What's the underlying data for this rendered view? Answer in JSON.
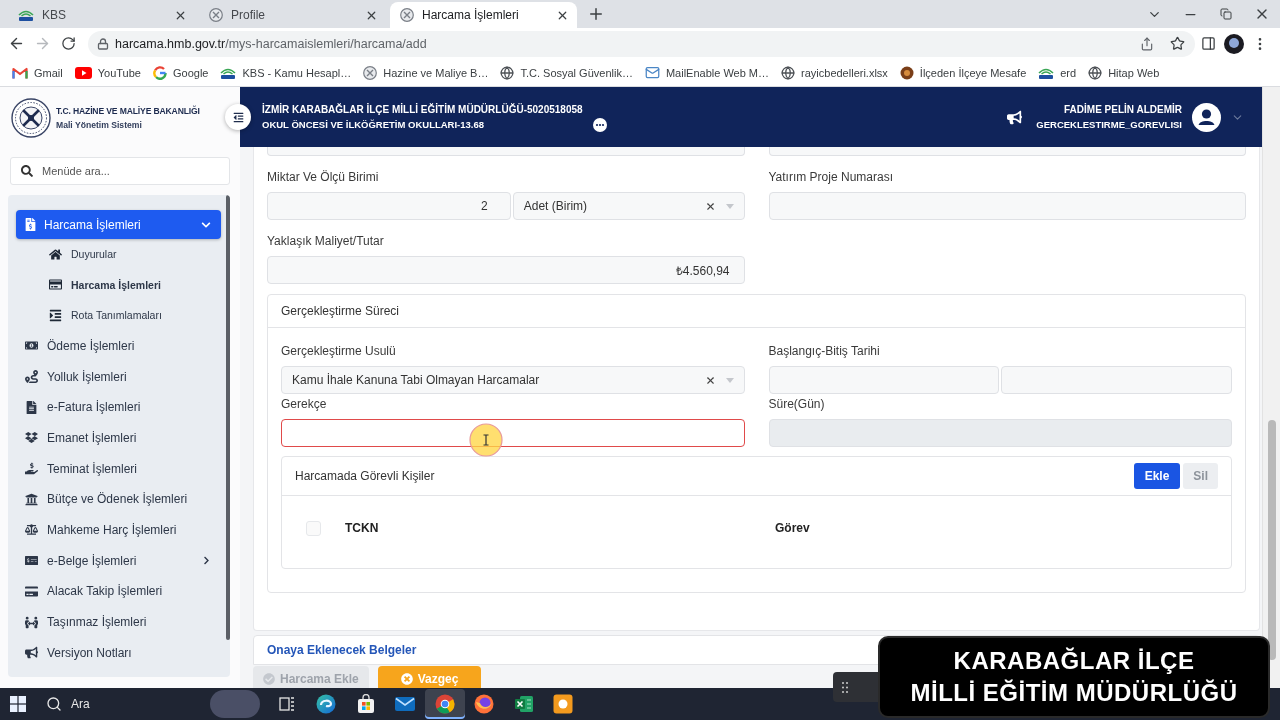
{
  "browser": {
    "tabs": [
      {
        "kind": "kbs",
        "title": "KBS",
        "selected": false
      },
      {
        "kind": "emblem",
        "title": "Profile",
        "selected": false
      },
      {
        "kind": "emblem",
        "title": "Harcama İşlemleri",
        "selected": true
      }
    ],
    "address": {
      "host": "harcama.hmb.gov.tr",
      "path": "/mys-harcamaislemleri/harcama/add"
    },
    "bookmarks": [
      {
        "kind": "gmail",
        "label": "Gmail"
      },
      {
        "kind": "youtube",
        "label": "YouTube"
      },
      {
        "kind": "google",
        "label": "Google"
      },
      {
        "kind": "kbs",
        "label": "KBS - Kamu Hesapl…"
      },
      {
        "kind": "emblem",
        "label": "Hazine ve Maliye B…"
      },
      {
        "kind": "globe",
        "label": "T.C. Sosyal Güvenlik…"
      },
      {
        "kind": "mail",
        "label": "MailEnable Web M…"
      },
      {
        "kind": "globe",
        "label": "rayicbedelleri.xlsx"
      },
      {
        "kind": "round",
        "label": "İlçeden İlçeye Mesafe"
      },
      {
        "kind": "kbs",
        "label": "erd"
      },
      {
        "kind": "globe",
        "label": "Hitap Web"
      }
    ]
  },
  "app": {
    "logo": {
      "title": "T.C. HAZİNE VE MALİYE BAKANLIĞI",
      "subtitle": "Mali Yönetim Sistemi"
    },
    "header": {
      "unit": "İZMİR KARABAĞLAR İLÇE MİLLİ EĞİTİM MÜDÜRLÜĞÜ-5020518058",
      "subunit": "OKUL ÖNCESİ VE İLKÖĞRETİM OKULLARI-13.68",
      "user": {
        "name": "FADİME PELİN ALDEMİR",
        "role": "GERCEKLESTIRME_GOREVLISI"
      }
    },
    "sidebar": {
      "search": {
        "placeholder": "Menüde ara..."
      },
      "items": [
        {
          "label": "Harcama İşlemleri",
          "selected": true,
          "expanded": true,
          "children": [
            {
              "label": "Duyurular",
              "selected": false
            },
            {
              "label": "Harcama İşlemleri",
              "selected": true
            },
            {
              "label": "Rota Tanımlamaları",
              "selected": false
            }
          ]
        },
        {
          "label": "Ödeme İşlemleri",
          "selected": false
        },
        {
          "label": "Yolluk İşlemleri",
          "selected": false
        },
        {
          "label": "e-Fatura İşlemleri",
          "selected": false
        },
        {
          "label": "Emanet İşlemleri",
          "selected": false
        },
        {
          "label": "Teminat İşlemleri",
          "selected": false
        },
        {
          "label": "Bütçe ve Ödenek İşlemleri",
          "selected": false
        },
        {
          "label": "Mahkeme Harç İşlemleri",
          "selected": false
        },
        {
          "label": "e-Belge İşlemleri",
          "selected": false,
          "expanded": false
        },
        {
          "label": "Alacak Takip İşlemleri",
          "selected": false
        },
        {
          "label": "Taşınmaz İşlemleri",
          "selected": false
        },
        {
          "label": "Versiyon Notları",
          "selected": false
        }
      ]
    },
    "form": {
      "fields": [
        {
          "kind": "quantity_unit",
          "label": "Miktar Ve Ölçü Birimi",
          "value": "2",
          "unit": "Adet (Birim)"
        },
        {
          "kind": "text",
          "label": "Yatırım Proje Numarası"
        },
        {
          "kind": "amount",
          "label": "Yaklaşık Maliyet/Tutar",
          "value": "₺4.560,94"
        }
      ],
      "process": {
        "title": "Gerçekleştirme Süreci",
        "fields": [
          {
            "kind": "select",
            "label": "Gerçekleştirme Usulü",
            "value": "Kamu İhale Kanuna Tabi Olmayan Harcamalar",
            "invalid": false,
            "disabled": false
          },
          {
            "kind": "date_range",
            "label": "Başlangıç-Bitiş Tarihi",
            "invalid": false,
            "disabled": false
          },
          {
            "kind": "text",
            "label": "Gerekçe",
            "invalid": true,
            "disabled": false
          },
          {
            "kind": "text",
            "label": "Süre(Gün)",
            "invalid": false,
            "disabled": true
          }
        ],
        "persons": {
          "title": "Harcamada Görevli Kişiler",
          "buttons": [
            {
              "label": "Ekle",
              "disabled": false
            },
            {
              "label": "Sil",
              "disabled": true
            }
          ],
          "select_all": {
            "checked": false
          },
          "columns": [
            "TCKN",
            "Görev"
          ]
        }
      }
    },
    "documents": {
      "title": "Onaya Eklenecek Belgeler"
    },
    "actions": [
      {
        "kind": "submit",
        "label": "Harcama Ekle",
        "disabled": true
      },
      {
        "kind": "cancel",
        "label": "Vazgeç",
        "disabled": false
      }
    ]
  },
  "taskbar": {
    "search": {
      "label": "Ara"
    },
    "apps": [
      {
        "kind": "task_view",
        "selected": false
      },
      {
        "kind": "edge",
        "selected": false
      },
      {
        "kind": "store",
        "selected": false
      },
      {
        "kind": "mail",
        "selected": false
      },
      {
        "kind": "chrome",
        "selected": true
      },
      {
        "kind": "firefox",
        "selected": false
      },
      {
        "kind": "excel",
        "selected": false
      },
      {
        "kind": "app",
        "selected": false
      }
    ]
  },
  "caption": {
    "lines": [
      "KARABAĞLAR İLÇE",
      "MİLLİ EĞİTİM MÜDÜRLÜĞÜ"
    ]
  }
}
